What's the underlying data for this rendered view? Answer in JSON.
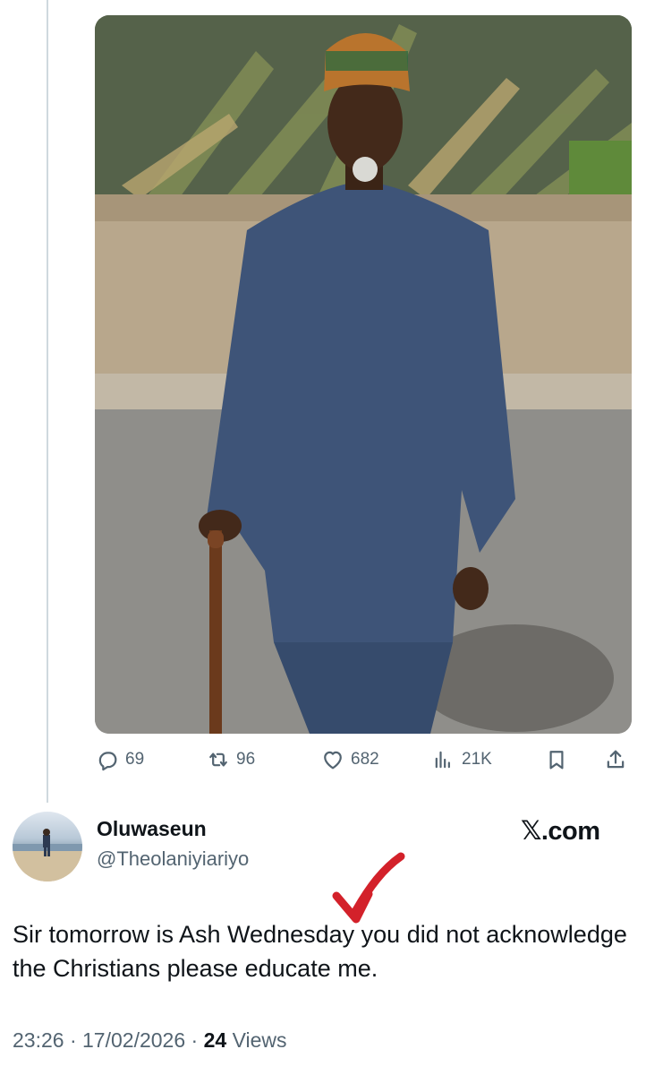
{
  "post": {
    "stats": {
      "replies": "69",
      "reposts": "96",
      "likes": "682",
      "views": "21K"
    }
  },
  "reply": {
    "display_name": "Oluwaseun",
    "handle": "@Theolaniyiariyo",
    "text": "Sir tomorrow is Ash Wednesday you did not acknowledge the Christians please educate me.",
    "time": "23:26",
    "date": "17/02/2026",
    "views_count": "24",
    "views_label": "Views"
  },
  "watermark": "𝕏.com",
  "annotation": {
    "arrow_color": "#d3212a"
  },
  "icons": [
    "reply-icon",
    "repost-icon",
    "like-icon",
    "views-icon",
    "bookmark-icon",
    "share-icon"
  ],
  "colors": {
    "text": "#0f1419",
    "secondary": "#536471",
    "line": "#cfd9de"
  }
}
